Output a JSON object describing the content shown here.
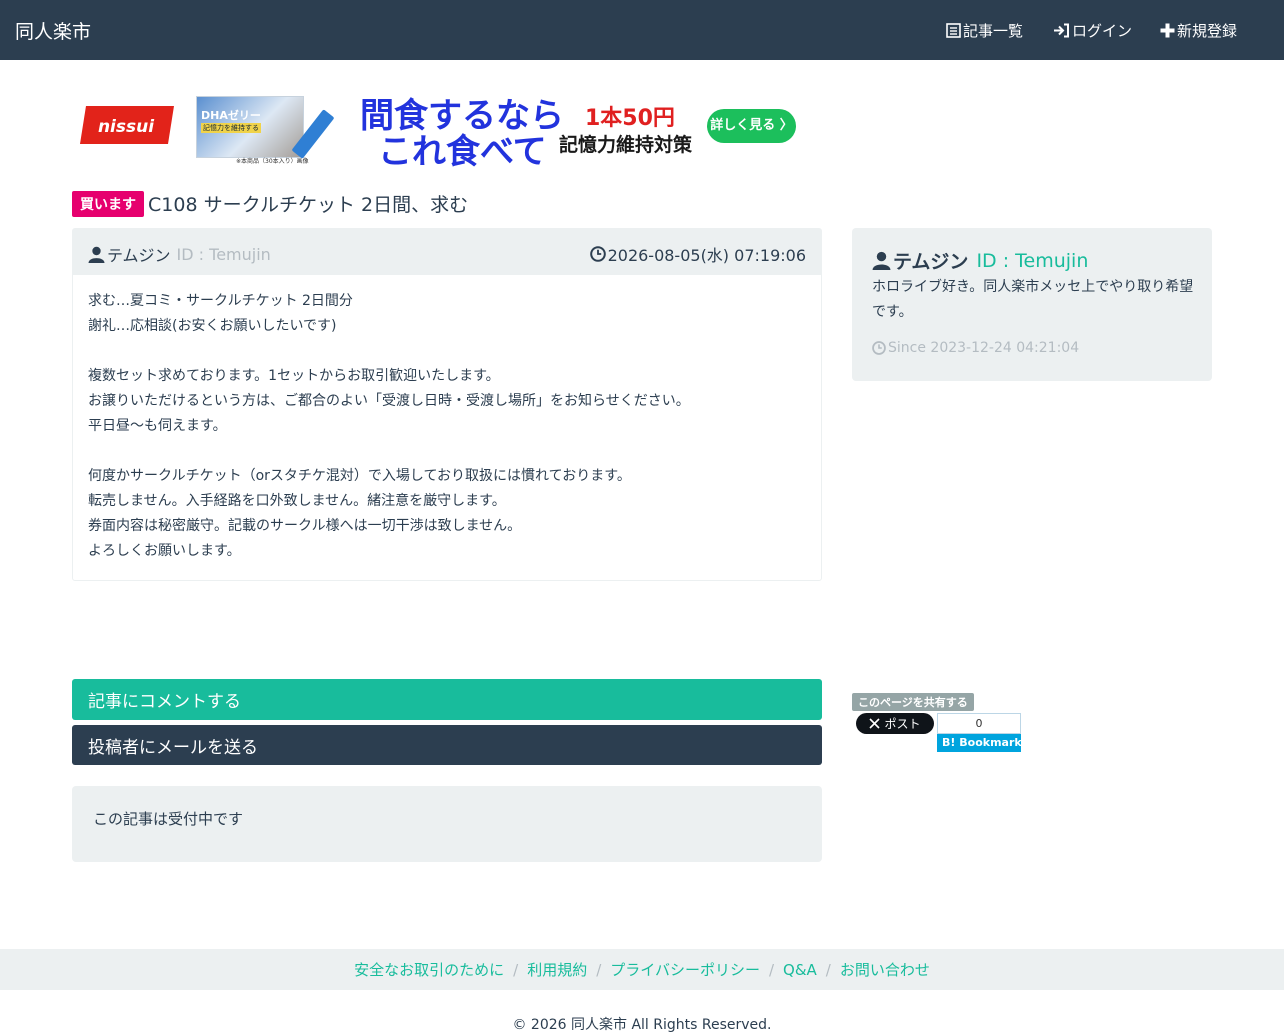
{
  "navbar": {
    "brand": "同人楽市",
    "links": [
      {
        "label": "記事一覧",
        "icon": "list-icon"
      },
      {
        "label": "ログイン",
        "icon": "login-icon"
      },
      {
        "label": "新規登録",
        "icon": "plus-icon"
      }
    ]
  },
  "ad": {
    "logo_text": "nissui",
    "product_title": "DHAゼリー",
    "product_sub": "記憶力を維持する",
    "product_caption": "※本商品（30本入り）画像",
    "headline_line1": "間食するなら",
    "headline_line2": "これ食べて",
    "price": "1本50円",
    "subline": "記憶力維持対策",
    "cta": "詳しく見る 〉"
  },
  "post": {
    "badge": "買います",
    "title": "C108 サークルチケット 2日間、求む",
    "author_name": "テムジン",
    "author_id": "ID : Temujin",
    "date": "2026-08-05(水) 07:19:06",
    "body_paragraphs": [
      [
        "求む…夏コミ・サークルチケット 2日間分",
        "謝礼…応相談(お安くお願いしたいです)"
      ],
      [
        "複数セット求めております。1セットからお取引歓迎いたします。",
        "お譲りいただけるという方は、ご都合のよい「受渡し日時・受渡し場所」をお知らせください。",
        "平日昼〜も伺えます。"
      ],
      [
        "何度かサークルチケット（orスタチケ混対）で入場しており取扱には慣れております。",
        "転売しません。入手経路を口外致しません。緒注意を厳守します。",
        "券面内容は秘密厳守。記載のサークル様へは一切干渉は致しません。",
        "よろしくお願いします。"
      ]
    ]
  },
  "profile": {
    "name": "テムジン",
    "id": "ID : Temujin",
    "intro": "ホロライブ好き。同人楽市メッセ上でやり取り希望です。",
    "since": "Since 2023-12-24 04:21:04"
  },
  "actions": {
    "comment": "記事にコメントする",
    "mail": "投稿者にメールを送る",
    "status": "この記事は受付中です"
  },
  "share": {
    "label": "このページを共有する",
    "x_label": "ポスト",
    "hatena_count": "0",
    "hatena_label": "Bookmark"
  },
  "footer": {
    "links": [
      "安全なお取引のために",
      "利用規約",
      "プライバシーポリシー",
      "Q&A",
      "お問い合わせ"
    ],
    "copyright": "© 2026 同人楽市 All Rights Reserved."
  },
  "colors": {
    "navbar": "#2c3e50",
    "accent": "#18bc9c",
    "badge": "#e6006e",
    "panel": "#ecf0f1"
  }
}
